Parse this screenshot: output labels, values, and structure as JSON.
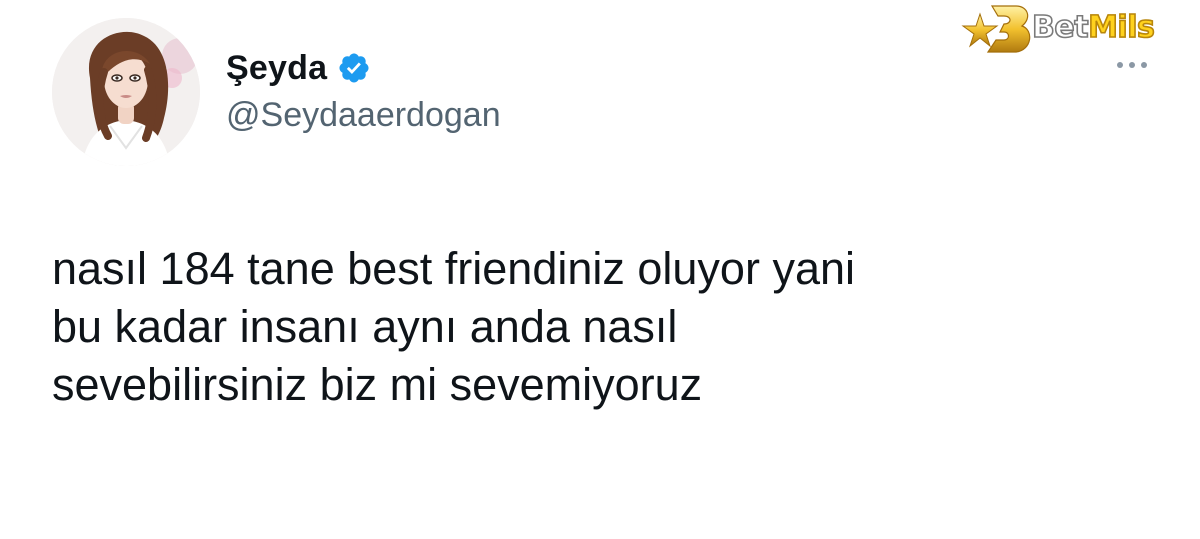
{
  "author": {
    "display_name": "Şeyda",
    "handle": "@Seydaaerdogan",
    "verified": true
  },
  "tweet": {
    "lines": [
      "nasıl 184 tane best friendiniz oluyor yani",
      "bu kadar insanı aynı anda nasıl",
      "sevebilirsiniz biz mi sevemiyoruz"
    ]
  },
  "watermark": {
    "text_main": "Bet",
    "text_accent": "Mils"
  },
  "icons": {
    "verified": "verified-badge-icon",
    "more": "more-options-icon",
    "logo": "betmils-logo-icon"
  },
  "colors": {
    "verified_blue": "#1d9bf0",
    "handle_gray": "#536471",
    "text": "#0f1419",
    "logo_gold": "#ffd21e"
  }
}
